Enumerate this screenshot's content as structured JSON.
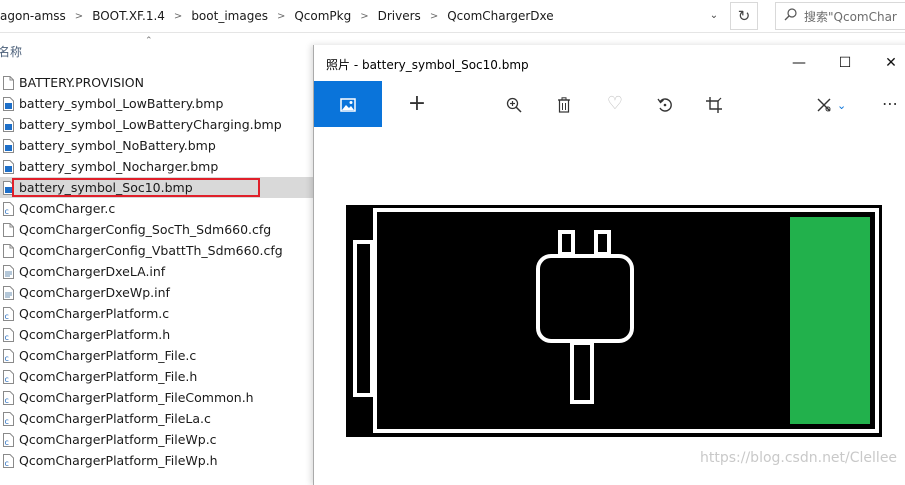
{
  "explorer": {
    "breadcrumbs": [
      "agon-amss",
      "BOOT.XF.1.4",
      "boot_images",
      "QcomPkg",
      "Drivers",
      "QcomChargerDxe"
    ],
    "search_placeholder": "搜索\"QcomChar",
    "column_name": "名称",
    "files": [
      {
        "name": "BATTERY.PROVISION",
        "icon": "blank-file-icon"
      },
      {
        "name": "battery_symbol_LowBattery.bmp",
        "icon": "bitmap-file-icon"
      },
      {
        "name": "battery_symbol_LowBatteryCharging.bmp",
        "icon": "bitmap-file-icon"
      },
      {
        "name": "battery_symbol_NoBattery.bmp",
        "icon": "bitmap-file-icon"
      },
      {
        "name": "battery_symbol_Nocharger.bmp",
        "icon": "bitmap-file-icon"
      },
      {
        "name": "battery_symbol_Soc10.bmp",
        "icon": "bitmap-file-icon",
        "selected": true
      },
      {
        "name": "QcomCharger.c",
        "icon": "c-file-icon"
      },
      {
        "name": "QcomChargerConfig_SocTh_Sdm660.cfg",
        "icon": "blank-file-icon"
      },
      {
        "name": "QcomChargerConfig_VbattTh_Sdm660.cfg",
        "icon": "blank-file-icon"
      },
      {
        "name": "QcomChargerDxeLA.inf",
        "icon": "inf-file-icon"
      },
      {
        "name": "QcomChargerDxeWp.inf",
        "icon": "inf-file-icon"
      },
      {
        "name": "QcomChargerPlatform.c",
        "icon": "c-file-icon"
      },
      {
        "name": "QcomChargerPlatform.h",
        "icon": "c-file-icon"
      },
      {
        "name": "QcomChargerPlatform_File.c",
        "icon": "c-file-icon"
      },
      {
        "name": "QcomChargerPlatform_File.h",
        "icon": "c-file-icon"
      },
      {
        "name": "QcomChargerPlatform_FileCommon.h",
        "icon": "c-file-icon"
      },
      {
        "name": "QcomChargerPlatform_FileLa.c",
        "icon": "c-file-icon"
      },
      {
        "name": "QcomChargerPlatform_FileWp.c",
        "icon": "c-file-icon"
      },
      {
        "name": "QcomChargerPlatform_FileWp.h",
        "icon": "c-file-icon"
      }
    ]
  },
  "photos": {
    "title": "照片 - battery_symbol_Soc10.bmp",
    "battery_level": 0.1,
    "battery_fill_color": "#22b14c"
  },
  "watermark": "https://blog.csdn.net/Clellee"
}
